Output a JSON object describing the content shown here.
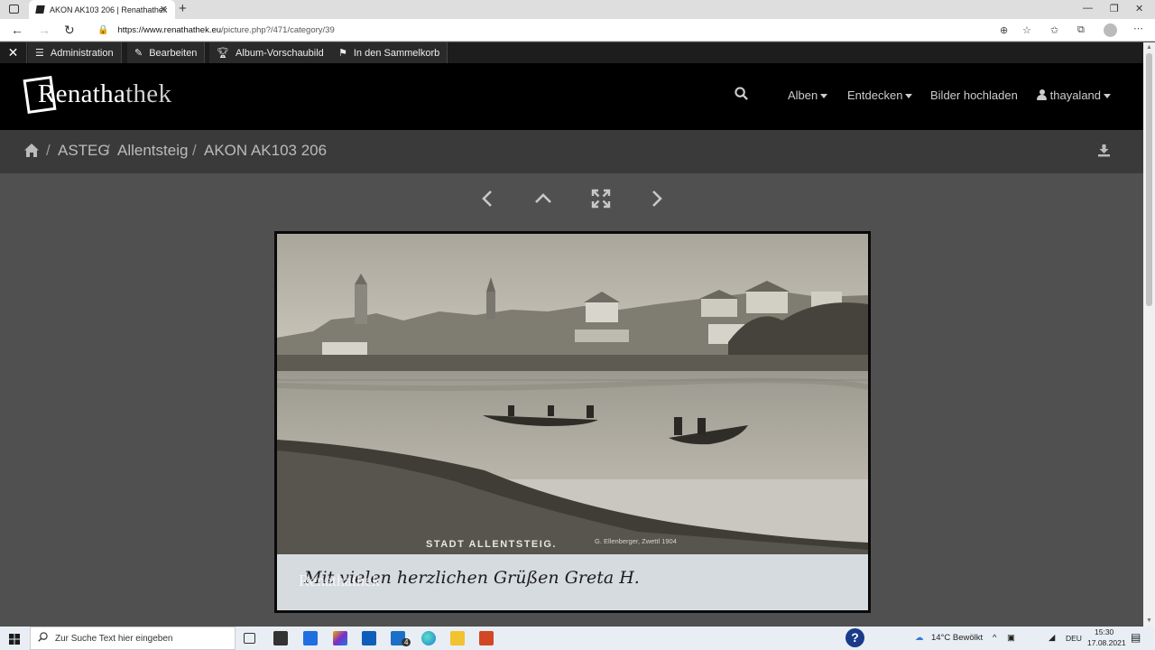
{
  "browser": {
    "tab_title": "AKON AK103 206 | Renathathek",
    "url_host": "https://www.renathathek.eu",
    "url_path": "/picture.php?/471/category/39"
  },
  "admin_bar": {
    "items": [
      {
        "label": "Administration",
        "icon": "menu-icon"
      },
      {
        "label": "Bearbeiten",
        "icon": "pencil-icon"
      },
      {
        "label": "Album-Vorschaubild",
        "icon": "trophy-icon"
      },
      {
        "label": "In den Sammelkorb",
        "icon": "flag-icon"
      }
    ]
  },
  "header": {
    "logo_prefix": "Renatha",
    "logo_suffix": "thek",
    "nav": {
      "albums": "Alben",
      "explore": "Entdecken",
      "upload": "Bilder hochladen",
      "user": "thayaland"
    }
  },
  "breadcrumb": {
    "items": [
      "ASTEG",
      "Allentsteig",
      "AKON AK103 206"
    ]
  },
  "photo": {
    "caption_print": "STADT   ALLENTSTEIG.",
    "publisher": "G. Ellenberger, Zwettl 1904",
    "handwriting": "Mit vielen herzlichen Grüßen   Greta H.",
    "watermark": "Renathathek"
  },
  "taskbar": {
    "search_placeholder": "Zur Suche Text hier eingeben",
    "weather": "14°C  Bewölkt",
    "lang": "DEU",
    "time": "15:30",
    "date": "17.08.2021",
    "mail_badge": "4"
  },
  "colors": {
    "header_bg": "#000000",
    "crumb_bg": "#3a3a3a",
    "main_bg": "#505050",
    "admin_bg": "#1d1d1d"
  }
}
